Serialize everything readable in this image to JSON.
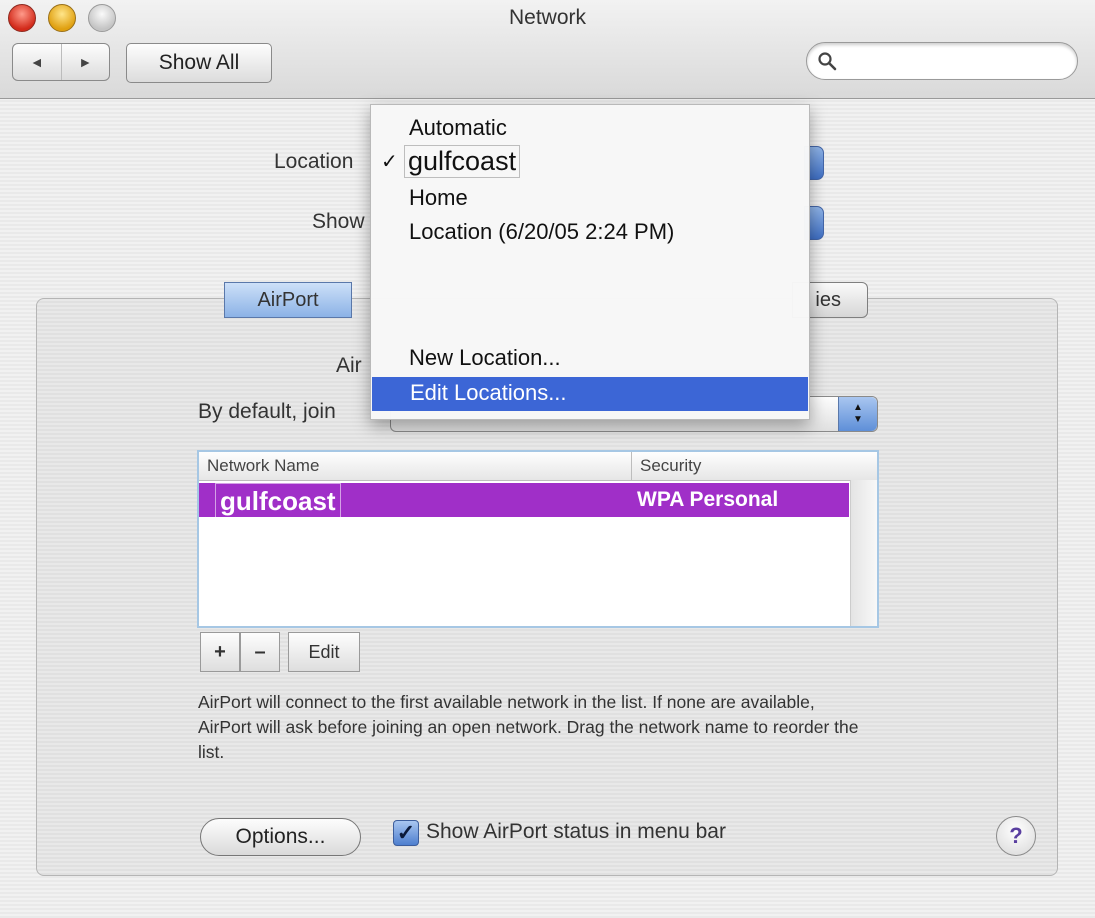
{
  "window": {
    "title": "Network"
  },
  "toolbar": {
    "back": "◄",
    "forward": "►",
    "show_all": "Show All",
    "search_placeholder": ""
  },
  "form": {
    "location_label": "Location",
    "show_label": "Show",
    "airport_label_partial": "Air",
    "join_label_partial": "By default, join"
  },
  "tabs": [
    {
      "label": "AirPort",
      "selected": true
    },
    {
      "label": "ies",
      "selected": false
    }
  ],
  "location_menu": {
    "items": [
      {
        "label": "Automatic",
        "checked": false
      },
      {
        "label": "gulfcoast",
        "checked": true
      },
      {
        "label": "Home",
        "checked": false
      },
      {
        "label": "Location (6/20/05 2:24 PM)",
        "checked": false
      },
      {
        "label": "New Location...",
        "checked": false
      },
      {
        "label": "Edit Locations...",
        "highlighted": true
      }
    ],
    "check_mark": "✓"
  },
  "network_table": {
    "columns": [
      "Network Name",
      "Security"
    ],
    "rows": [
      {
        "name": "gulfcoast",
        "security": "WPA Personal",
        "selected": true
      }
    ]
  },
  "list_buttons": {
    "add": "+",
    "remove": "–",
    "edit": "Edit"
  },
  "help_text": "AirPort will connect to the first available network in the list. If none are available, AirPort will ask before joining an open network. Drag the network name to reorder the list.",
  "footer": {
    "options_button": "Options...",
    "show_status_label": "Show AirPort status in menu bar",
    "show_status_checked": true,
    "help_button": "?"
  }
}
